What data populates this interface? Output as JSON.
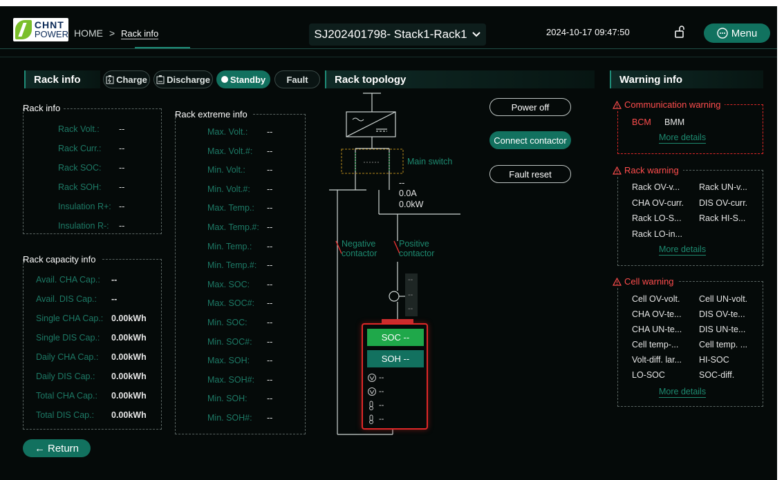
{
  "header": {
    "logo_line1": "CHNT",
    "logo_line2": "POWER",
    "crumb_home": "HOME",
    "crumb_sep": ">",
    "crumb_current": "Rack info",
    "device": "SJ202401798- Stack1-Rack1",
    "datetime": "2024-10-17 09:47:50",
    "menu_label": "Menu"
  },
  "rack_panel": {
    "title": "Rack info",
    "modes": [
      "Charge",
      "Discharge",
      "Standby",
      "Fault"
    ],
    "active_mode": "Standby"
  },
  "rack_info": {
    "title": "Rack info",
    "rows": [
      {
        "label": "Rack Volt.:",
        "value": "--"
      },
      {
        "label": "Rack Curr.:",
        "value": "--"
      },
      {
        "label": "Rack SOC:",
        "value": "--"
      },
      {
        "label": "Rack SOH:",
        "value": "--"
      },
      {
        "label": "Insulation R+:",
        "value": "--"
      },
      {
        "label": "Insulation R-:",
        "value": "--"
      }
    ]
  },
  "capacity_info": {
    "title": "Rack capacity info",
    "rows": [
      {
        "label": "Avail. CHA Cap.:",
        "value": "--"
      },
      {
        "label": "Avail. DIS Cap.:",
        "value": "--"
      },
      {
        "label": "Single CHA Cap.:",
        "value": "0.00kWh"
      },
      {
        "label": "Single DIS Cap.:",
        "value": "0.00kWh"
      },
      {
        "label": "Daily CHA Cap.:",
        "value": "0.00kWh"
      },
      {
        "label": "Daily DIS Cap.:",
        "value": "0.00kWh"
      },
      {
        "label": "Total CHA Cap.:",
        "value": "0.00kWh"
      },
      {
        "label": "Total DIS Cap.:",
        "value": "0.00kWh"
      }
    ]
  },
  "extreme_info": {
    "title": "Rack extreme info",
    "rows": [
      {
        "label": "Max. Volt.:",
        "value": "--"
      },
      {
        "label": "Max. Volt.#:",
        "value": "--"
      },
      {
        "label": "Min. Volt.:",
        "value": "--"
      },
      {
        "label": "Min. Volt.#:",
        "value": "--"
      },
      {
        "label": "Max. Temp.:",
        "value": "--"
      },
      {
        "label": "Max. Temp.#:",
        "value": "--"
      },
      {
        "label": "Min. Temp.:",
        "value": "--"
      },
      {
        "label": "Min. Temp.#:",
        "value": "--"
      },
      {
        "label": "Max. SOC:",
        "value": "--"
      },
      {
        "label": "Max. SOC#:",
        "value": "--"
      },
      {
        "label": "Min. SOC:",
        "value": "--"
      },
      {
        "label": "Min. SOC#:",
        "value": "--"
      },
      {
        "label": "Max. SOH:",
        "value": "--"
      },
      {
        "label": "Max. SOH#:",
        "value": "--"
      },
      {
        "label": "Min. SOH:",
        "value": "--"
      },
      {
        "label": "Min. SOH#:",
        "value": "--"
      }
    ]
  },
  "topology": {
    "title": "Rack topology",
    "main_switch": "Main switch",
    "bus_dash": "--",
    "bus_current": "0.0A",
    "bus_power": "0.0kW",
    "negative_contactor": "Negative contactor",
    "positive_contactor": "Positive contactor",
    "meter_values": [
      "--",
      "--",
      "--"
    ],
    "soc_label": "SOC --",
    "soh_label": "SOH --",
    "metrics": [
      "--",
      "--",
      "--",
      "--"
    ]
  },
  "actions": {
    "power_off": "Power off",
    "connect_contactor": "Connect contactor",
    "fault_reset": "Fault reset"
  },
  "warning": {
    "title": "Warning info",
    "communication": {
      "title": "Communication warning",
      "items": [
        "BCM",
        "BMM"
      ],
      "active": [
        "BCM"
      ],
      "more": "More details"
    },
    "rack": {
      "title": "Rack warning",
      "items": [
        "Rack OV-v...",
        "Rack UN-v...",
        "CHA OV-curr.",
        "DIS OV-curr.",
        "Rack LO-S...",
        "Rack HI-S...",
        "Rack LO-in..."
      ],
      "more": "More details"
    },
    "cell": {
      "title": "Cell warning",
      "items": [
        "Cell OV-volt.",
        "Cell UN-volt.",
        "CHA OV-te...",
        "DIS OV-te...",
        "CHA UN-te...",
        "DIS UN-te...",
        "Cell temp-...",
        "Cell temp. ...",
        "Volt-diff. lar...",
        "HI-SOC",
        "LO-SOC",
        "SOC-diff."
      ],
      "more": "More details"
    }
  },
  "footer": {
    "return_label": "Return"
  },
  "colors": {
    "bg": "#050a09",
    "accent": "#12715f",
    "label_green": "#1d7a66",
    "warning_red": "#ff4d4d",
    "soc_green": "#1fa84a"
  }
}
